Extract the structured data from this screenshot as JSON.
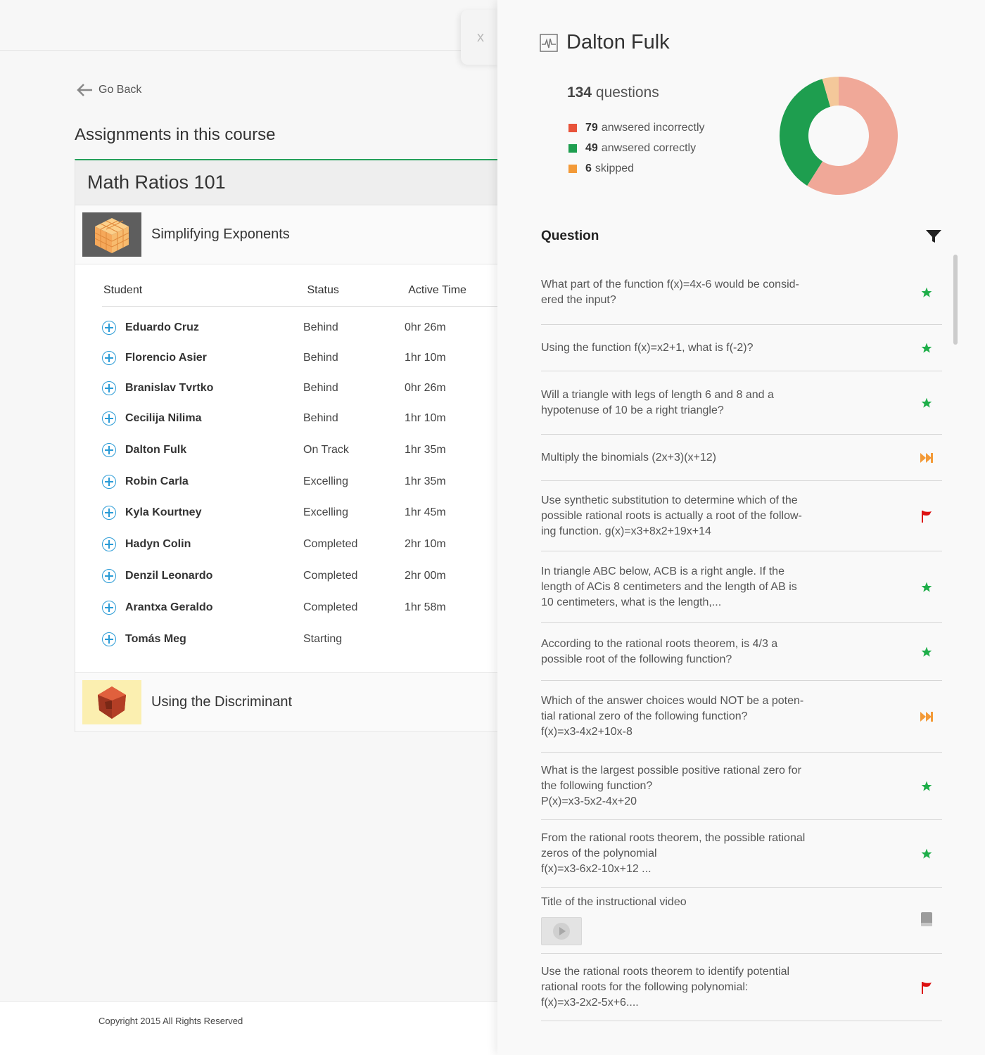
{
  "close_label": "x",
  "back_label": "Go Back",
  "assignments_heading": "Assignments in this course",
  "course_name": "Math Ratios 101",
  "assignments": [
    {
      "title": "Simplifying Exponents",
      "icon": "cube-icon"
    },
    {
      "title": "Using the Discriminant",
      "icon": "gem-icon"
    }
  ],
  "table": {
    "headers": {
      "student": "Student",
      "status": "Status",
      "time": "Active Time"
    },
    "rows": [
      {
        "name": "Eduardo Cruz",
        "status": "Behind",
        "time": "0hr 26m"
      },
      {
        "name": "Florencio Asier",
        "status": "Behind",
        "time": "1hr 10m"
      },
      {
        "name": "Branislav Tvrtko",
        "status": "Behind",
        "time": "0hr 26m"
      },
      {
        "name": "Cecilija Nilima",
        "status": "Behind",
        "time": "1hr 10m"
      },
      {
        "name": "Dalton Fulk",
        "status": "On Track",
        "time": "1hr 35m"
      },
      {
        "name": "Robin Carla",
        "status": "Excelling",
        "time": "1hr 35m"
      },
      {
        "name": "Kyla Kourtney",
        "status": "Excelling",
        "time": "1hr 45m"
      },
      {
        "name": "Hadyn Colin",
        "status": "Completed",
        "time": "2hr 10m"
      },
      {
        "name": "Denzil Leonardo",
        "status": "Completed",
        "time": "2hr 00m"
      },
      {
        "name": "Arantxa Geraldo",
        "status": "Completed",
        "time": "1hr 58m"
      },
      {
        "name": "Tomás Meg",
        "status": "Starting",
        "time": ""
      }
    ]
  },
  "footer": {
    "copyright": "Copyright 2015 All Rights Reserved"
  },
  "panel": {
    "student_name": "Dalton Fulk",
    "question_count": "134",
    "question_count_label": "questions",
    "stats": [
      {
        "value": "79",
        "label": "anwsered incorrectly",
        "color": "#e8533a"
      },
      {
        "value": "49",
        "label": "anwsered correctly",
        "color": "#1e9e4f"
      },
      {
        "value": "6",
        "label": "skipped",
        "color": "#f39a38"
      }
    ],
    "chart_data": {
      "type": "pie",
      "categories": [
        "anwsered incorrectly",
        "anwsered correctly",
        "skipped"
      ],
      "values": [
        79,
        49,
        6
      ],
      "colors": [
        "#f0a898",
        "#1e9e4f",
        "#f4c89a"
      ]
    },
    "question_header": "Question",
    "questions": [
      {
        "text": "What part of the function f(x)=4x-6 would be consid-\nered the input?",
        "icon": "star-icon"
      },
      {
        "text": "Using the function f(x)=x2+1, what is f(-2)?",
        "icon": "star-icon"
      },
      {
        "text": "Will a triangle with legs of length 6 and 8 and a\nhypotenuse of 10 be a right triangle?",
        "icon": "star-icon"
      },
      {
        "text": "Multiply the binomials (2x+3)(x+12)",
        "icon": "skip-icon"
      },
      {
        "text": "Use synthetic substitution to determine which of the\npossible rational roots is actually a root of the follow-\ning function. g(x)=x3+8x2+19x+14",
        "icon": "flag-icon"
      },
      {
        "text": "In triangle ABC below, ACB is a right angle. If the\nlength of ACis 8 centimeters and the length of AB is\n10 centimeters, what is the length,...",
        "icon": "star-icon"
      },
      {
        "text": "According to the rational roots theorem, is 4/3 a\npossible root of the following function?",
        "icon": "star-icon"
      },
      {
        "text": "Which of the answer choices would NOT be a poten-\ntial rational zero of the following function?\n                    f(x)=x3-4x2+10x-8",
        "icon": "skip-icon"
      },
      {
        "text": "What is the largest possible positive rational zero for\nthe following function?\n                    P(x)=x3-5x2-4x+20",
        "icon": "star-icon"
      },
      {
        "text": "From the rational roots theorem, the possible rational\nzeros of the polynomial\n                  f(x)=x3-6x2-10x+12 ...",
        "icon": "star-icon"
      },
      {
        "text": "Title of the instructional video",
        "icon": "book-icon",
        "video": true
      },
      {
        "text": "Use the rational roots theorem to identify potential\nrational roots for the following polynomial:\n                    f(x)=x3-2x2-5x+6....",
        "icon": "flag-icon"
      }
    ]
  }
}
